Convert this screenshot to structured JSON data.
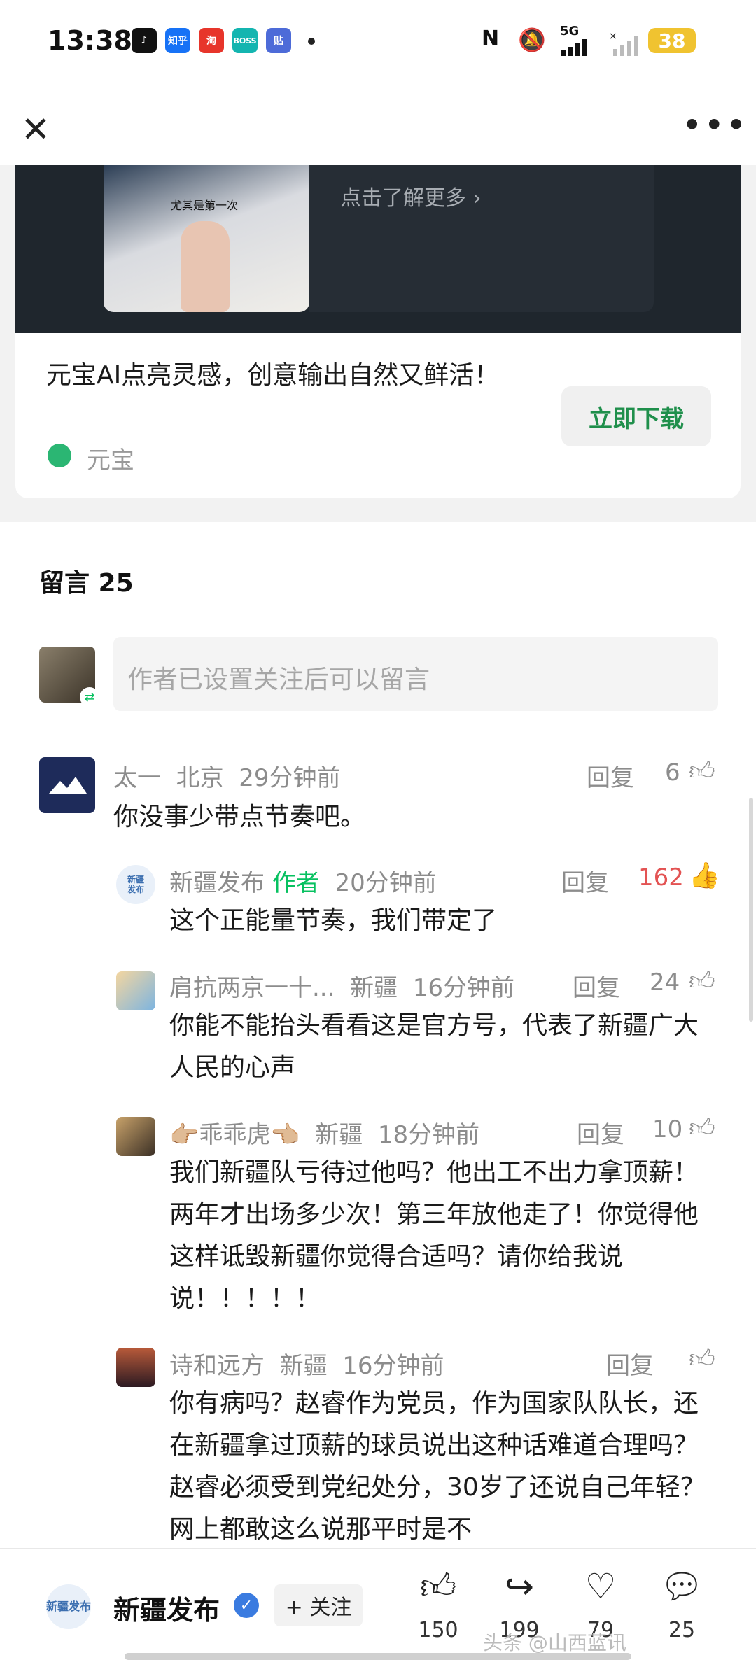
{
  "status_bar": {
    "time": "13:38",
    "apps": [
      {
        "label": "♪",
        "color": "#111111"
      },
      {
        "label": "知乎",
        "color": "#1772f6"
      },
      {
        "label": "淘",
        "color": "#e7352b"
      },
      {
        "label": "BOSS",
        "color": "#14b5b0"
      },
      {
        "label": "贴",
        "color": "#4d6bd8"
      }
    ],
    "signal_label": "5G",
    "battery": "38"
  },
  "ad": {
    "image_caption": "尤其是第一次",
    "learn_more": "点击了解更多 ›",
    "title": "元宝AI点亮灵感，创意输出自然又鲜活！",
    "download_button": "立即下载",
    "brand": "元宝"
  },
  "comments": {
    "heading": "留言 25",
    "input_placeholder": "作者已设置关注后可以留言",
    "reply_label": "回复",
    "items": [
      {
        "name": "太一",
        "location": "北京",
        "time": "29分钟前",
        "likes": "6",
        "text": "你没事少带点节奏吧。"
      },
      {
        "name": "新疆发布",
        "author_tag": "作者",
        "time": "20分钟前",
        "likes": "162",
        "text": "这个正能量节奏，我们带定了"
      },
      {
        "name": "肩抗两京一十...",
        "location": "新疆",
        "time": "16分钟前",
        "likes": "24",
        "text": "你能不能抬头看看这是官方号，代表了新疆广大人民的心声"
      },
      {
        "name": "👉🏼乖乖虎👈🏼",
        "location": "新疆",
        "time": "18分钟前",
        "likes": "10",
        "text": "我们新疆队亏待过他吗？他出工不出力拿顶薪！两年才出场多少次！第三年放他走了！你觉得他这样诋毁新疆你觉得合适吗？请你给我说说！！！！！"
      },
      {
        "name": "诗和远方",
        "location": "新疆",
        "time": "16分钟前",
        "likes": "",
        "text": "你有病吗？赵睿作为党员，作为国家队队长，还在新疆拿过顶薪的球员说出这种话难道合理吗？赵睿必须受到党纪处分，30岁了还说自己年轻？网上都敢这么说那平时是不"
      }
    ]
  },
  "bottom_bar": {
    "avatar_text": "新疆发布",
    "account_name": "新疆发布",
    "follow_label": "+ 关注",
    "like_count": "150",
    "share_count": "199",
    "fav_count": "79",
    "comment_count": "25",
    "watermark": "头条 @山西蓝讯"
  },
  "colors": {
    "accent_green": "#07c160",
    "like_red": "#e35353",
    "verified_blue": "#3a7be0"
  }
}
